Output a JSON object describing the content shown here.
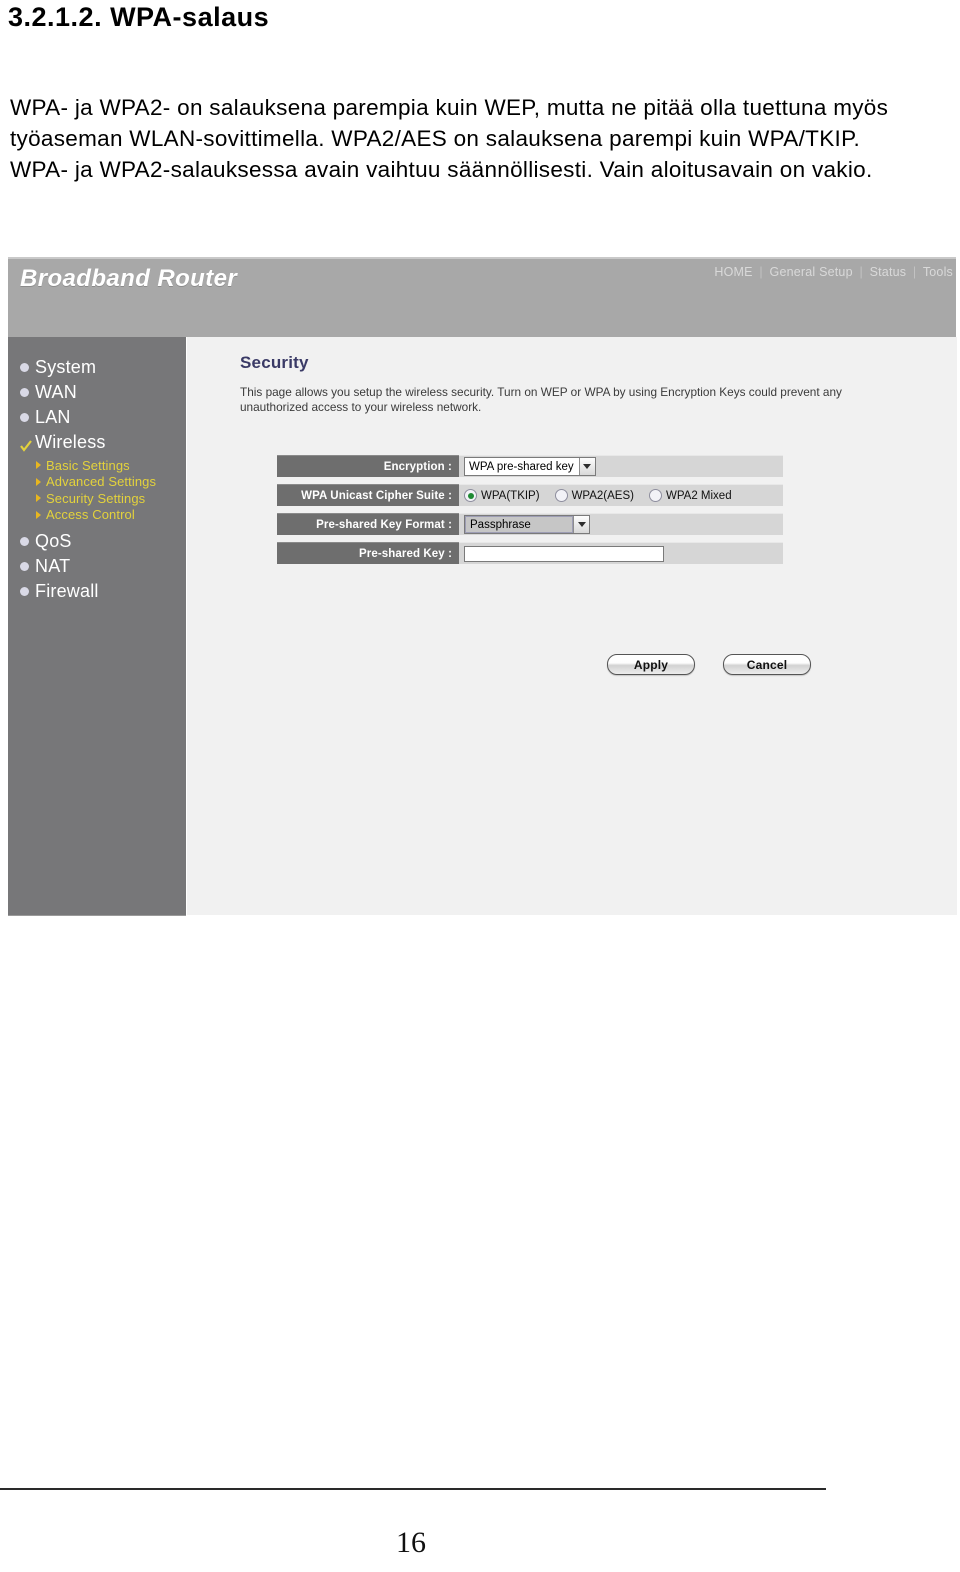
{
  "document": {
    "heading": "3.2.1.2. WPA-salaus",
    "body": "WPA- ja WPA2- on salauksena parempia kuin WEP, mutta ne pitää olla tuettuna myös työaseman WLAN-sovittimella. WPA2/AES on salauksena parempi kuin WPA/TKIP. WPA- ja WPA2-salauksessa avain vaihtuu säännöllisesti. Vain aloitusavain on vakio.",
    "page_number": "16"
  },
  "screenshot": {
    "brand": "Broadband Router",
    "topnav": {
      "separator": "|",
      "items": [
        {
          "label": "HOME"
        },
        {
          "label": "General Setup"
        },
        {
          "label": "Status"
        },
        {
          "label": "Tools"
        }
      ]
    },
    "sidebar": {
      "items": [
        {
          "label": "System",
          "marker": "bullet"
        },
        {
          "label": "WAN",
          "marker": "bullet"
        },
        {
          "label": "LAN",
          "marker": "bullet"
        },
        {
          "label": "Wireless",
          "marker": "check"
        },
        {
          "label": "QoS",
          "marker": "bullet"
        },
        {
          "label": "NAT",
          "marker": "bullet"
        },
        {
          "label": "Firewall",
          "marker": "bullet"
        }
      ],
      "wireless_subitems": [
        {
          "label": "Basic Settings"
        },
        {
          "label": "Advanced Settings"
        },
        {
          "label": "Security Settings"
        },
        {
          "label": "Access Control"
        }
      ]
    },
    "content": {
      "title": "Security",
      "description": "This page allows you setup the wireless security. Turn on WEP or WPA by using Encryption Keys could prevent any unauthorized access to your wireless network.",
      "rows": {
        "encryption": {
          "label": "Encryption :",
          "value": "WPA pre-shared key"
        },
        "cipher_suite": {
          "label": "WPA Unicast Cipher Suite :",
          "options": [
            {
              "label": "WPA(TKIP)",
              "checked": true
            },
            {
              "label": "WPA2(AES)",
              "checked": false
            },
            {
              "label": "WPA2 Mixed",
              "checked": false
            }
          ]
        },
        "key_format": {
          "label": "Pre-shared Key Format :",
          "value": "Passphrase"
        },
        "preshared_key": {
          "label": "Pre-shared Key :",
          "value": ""
        }
      },
      "buttons": {
        "apply": "Apply",
        "cancel": "Cancel"
      }
    },
    "colors": {
      "header_band": "#a8a8a8",
      "sidebar": "#777779",
      "content_bg": "#f1f1f1",
      "row_label_bg": "#6e6e6e",
      "row_field_bg": "#d6d6d6",
      "title_text": "#3a3a66",
      "submenu_text": "#e3d23c",
      "radio_dot": "#1f8a34"
    }
  }
}
